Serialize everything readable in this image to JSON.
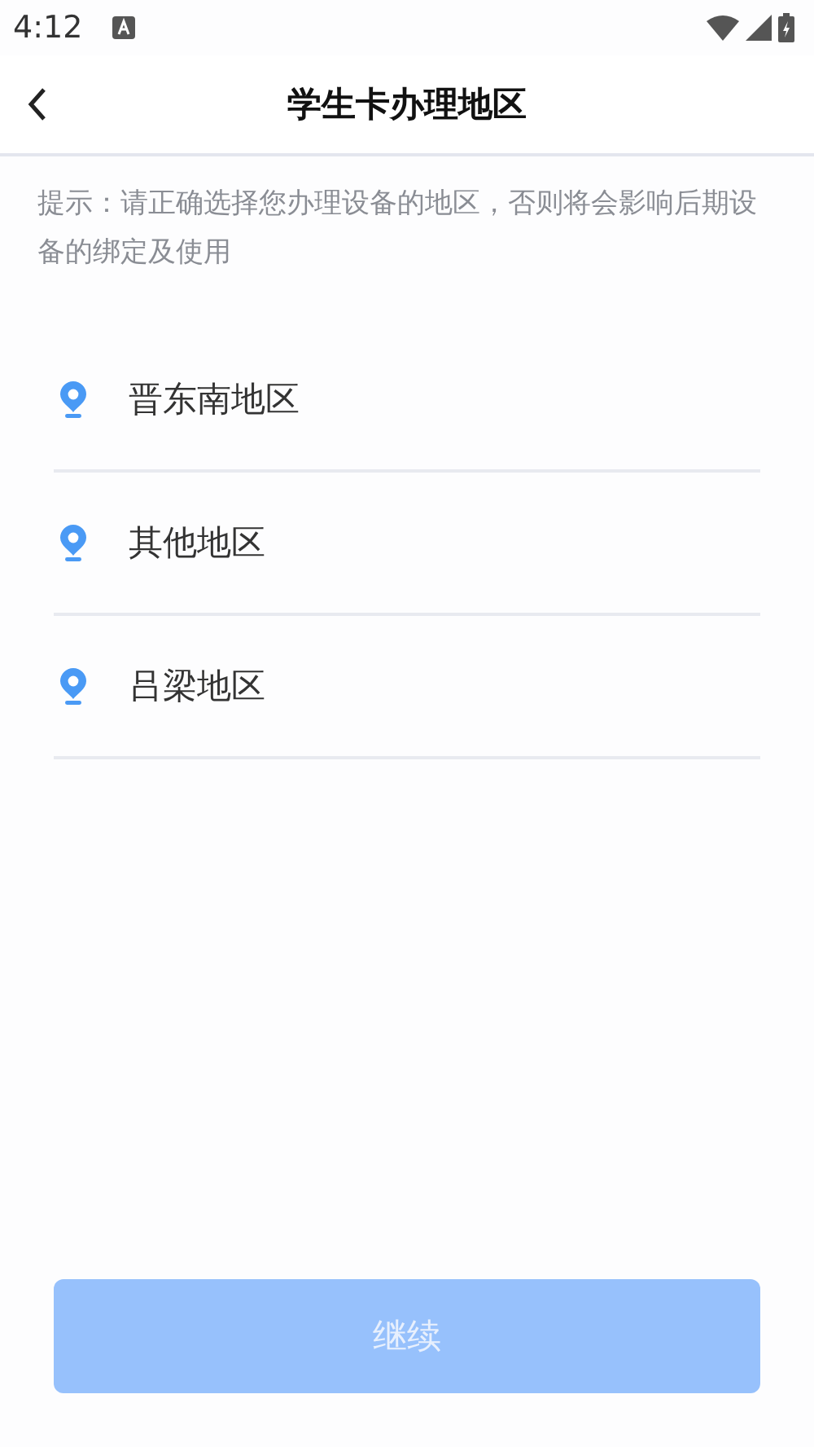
{
  "status_bar": {
    "time": "4:12"
  },
  "header": {
    "title": "学生卡办理地区"
  },
  "hint": "提示：请正确选择您办理设备的地区，否则将会影响后期设备的绑定及使用",
  "regions": [
    {
      "name": "晋东南地区"
    },
    {
      "name": "其他地区"
    },
    {
      "name": "吕梁地区"
    }
  ],
  "continue_button": {
    "label": "继续",
    "disabled": true
  }
}
